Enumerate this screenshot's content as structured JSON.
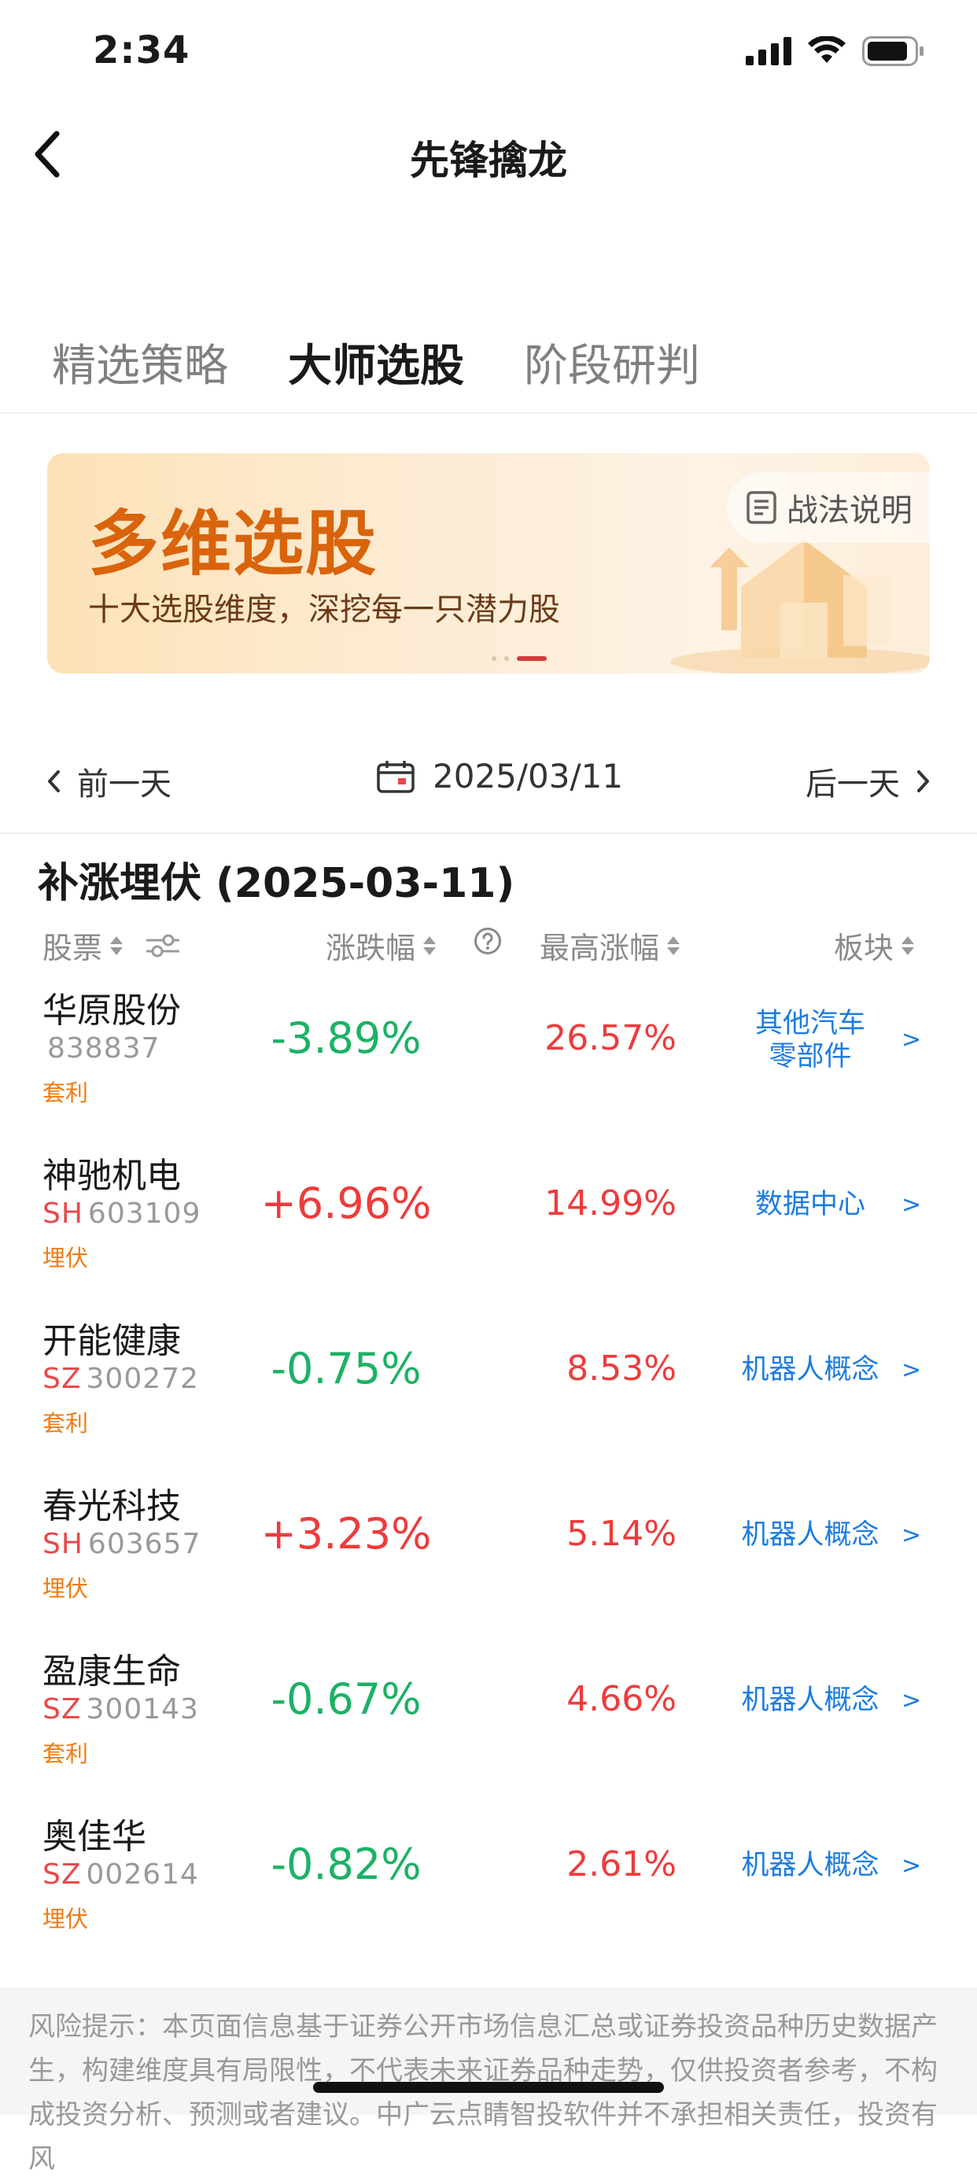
{
  "status_bar": {
    "time": "2:34"
  },
  "nav": {
    "title": "先锋擒龙"
  },
  "tabs": [
    {
      "label": "精选策略",
      "active": false
    },
    {
      "label": "大师选股",
      "active": true
    },
    {
      "label": "阶段研判",
      "active": false
    }
  ],
  "banner": {
    "title": "多维选股",
    "subtitle": "十大选股维度，深挖每一只潜力股",
    "help_label": "战法说明",
    "page_count": 3,
    "active_page": 3
  },
  "date_nav": {
    "prev_label": "前一天",
    "date": "2025/03/11",
    "next_label": "后一天"
  },
  "section": {
    "title": "补涨埋伏 (2025-03-11)"
  },
  "table": {
    "headers": {
      "stock": "股票",
      "change": "涨跌幅",
      "max_gain": "最高涨幅",
      "sector": "板块"
    },
    "rows": [
      {
        "name": "华原股份",
        "exchange": "",
        "code": "838837",
        "tag": "套利",
        "change": "-3.89%",
        "max_gain": "26.57%",
        "sector_line1": "其他汽车",
        "sector_line2": "零部件"
      },
      {
        "name": "神驰机电",
        "exchange": "SH",
        "code": "603109",
        "tag": "埋伏",
        "change": "+6.96%",
        "max_gain": "14.99%",
        "sector_line1": "数据中心",
        "sector_line2": ""
      },
      {
        "name": "开能健康",
        "exchange": "SZ",
        "code": "300272",
        "tag": "套利",
        "change": "-0.75%",
        "max_gain": "8.53%",
        "sector_line1": "机器人概念",
        "sector_line2": ""
      },
      {
        "name": "春光科技",
        "exchange": "SH",
        "code": "603657",
        "tag": "埋伏",
        "change": "+3.23%",
        "max_gain": "5.14%",
        "sector_line1": "机器人概念",
        "sector_line2": ""
      },
      {
        "name": "盈康生命",
        "exchange": "SZ",
        "code": "300143",
        "tag": "套利",
        "change": "-0.67%",
        "max_gain": "4.66%",
        "sector_line1": "机器人概念",
        "sector_line2": ""
      },
      {
        "name": "奥佳华",
        "exchange": "SZ",
        "code": "002614",
        "tag": "埋伏",
        "change": "-0.82%",
        "max_gain": "2.61%",
        "sector_line1": "机器人概念",
        "sector_line2": ""
      }
    ]
  },
  "risk_notice": "风险提示：本页面信息基于证券公开市场信息汇总或证券投资品种历史数据产生，构建维度具有局限性，不代表未来证券品种走势，仅供投资者参考，不构成投资分析、预测或者建议。中广云点睛智投软件并不承担相关责任，投资有风",
  "colors": {
    "up": "#ee3b3b",
    "down": "#1bb265",
    "sector_link": "#1c7ce0",
    "tag": "#f07b11",
    "banner_title": "#d9640c"
  }
}
